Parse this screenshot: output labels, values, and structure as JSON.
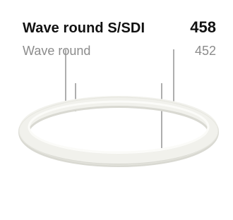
{
  "product": {
    "name": "Wave round S/SDI",
    "code": "458",
    "variant_name": "Wave round",
    "variant_code": "452"
  },
  "image": {
    "icon": "ring-pendant-luminaire-icon",
    "ring_color": "#f1f1ec",
    "shadow_color": "#dcdcd4",
    "cable_color": "#6b6b6b"
  }
}
